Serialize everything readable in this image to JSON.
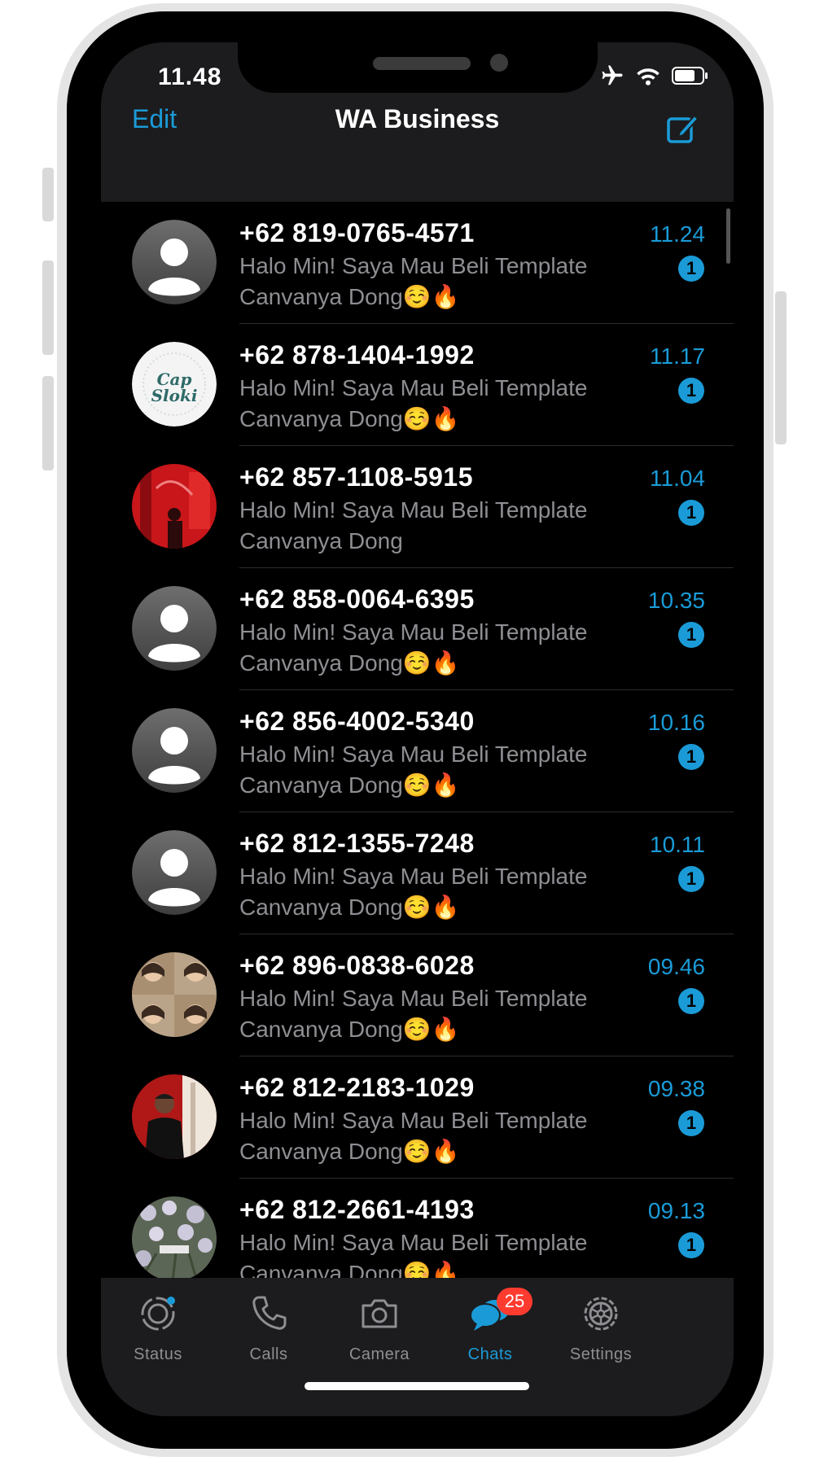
{
  "status_bar": {
    "time": "11.48"
  },
  "nav": {
    "edit": "Edit",
    "title": "WA Business"
  },
  "chats": [
    {
      "name": "+62 819-0765-4571",
      "time": "11.24",
      "badge": "1",
      "message": "Halo Min! Saya Mau Beli Template Canvanya Dong☺️🔥",
      "avatar": "default"
    },
    {
      "name": "+62 878-1404-1992",
      "time": "11.17",
      "badge": "1",
      "message": "Halo Min! Saya Mau Beli Template Canvanya Dong☺️🔥",
      "avatar": "logo",
      "logo_text": "Cap Sloki"
    },
    {
      "name": "+62 857-1108-5915",
      "time": "11.04",
      "badge": "1",
      "message": "Halo Min! Saya Mau Beli Template Canvanya Dong",
      "avatar": "photo-red"
    },
    {
      "name": "+62 858-0064-6395",
      "time": "10.35",
      "badge": "1",
      "message": "Halo Min! Saya Mau Beli Template Canvanya Dong☺️🔥",
      "avatar": "default"
    },
    {
      "name": "+62 856-4002-5340",
      "time": "10.16",
      "badge": "1",
      "message": "Halo Min! Saya Mau Beli Template Canvanya Dong☺️🔥",
      "avatar": "default"
    },
    {
      "name": "+62 812-1355-7248",
      "time": "10.11",
      "badge": "1",
      "message": "Halo Min! Saya Mau Beli Template Canvanya Dong☺️🔥",
      "avatar": "default"
    },
    {
      "name": "+62 896-0838-6028",
      "time": "09.46",
      "badge": "1",
      "message": "Halo Min! Saya Mau Beli Template Canvanya Dong☺️🔥",
      "avatar": "photo-collage"
    },
    {
      "name": "+62 812-2183-1029",
      "time": "09.38",
      "badge": "1",
      "message": "Halo Min! Saya Mau Beli Template Canvanya Dong☺️🔥",
      "avatar": "photo-person"
    },
    {
      "name": "+62 812-2661-4193",
      "time": "09.13",
      "badge": "1",
      "message": "Halo Min! Saya Mau Beli Template Canvanya Dong☺️🔥",
      "avatar": "photo-flowers"
    }
  ],
  "tabs": [
    {
      "label": "Status",
      "icon": "status-icon"
    },
    {
      "label": "Calls",
      "icon": "phone-icon"
    },
    {
      "label": "Camera",
      "icon": "camera-icon"
    },
    {
      "label": "Chats",
      "icon": "chat-bubbles-icon",
      "badge": "25",
      "active": true
    },
    {
      "label": "Settings",
      "icon": "gear-icon"
    }
  ],
  "colors": {
    "accent": "#1a9bd7",
    "badge_red": "#ff3b30",
    "background": "#000000",
    "bar": "#1c1c1e"
  }
}
